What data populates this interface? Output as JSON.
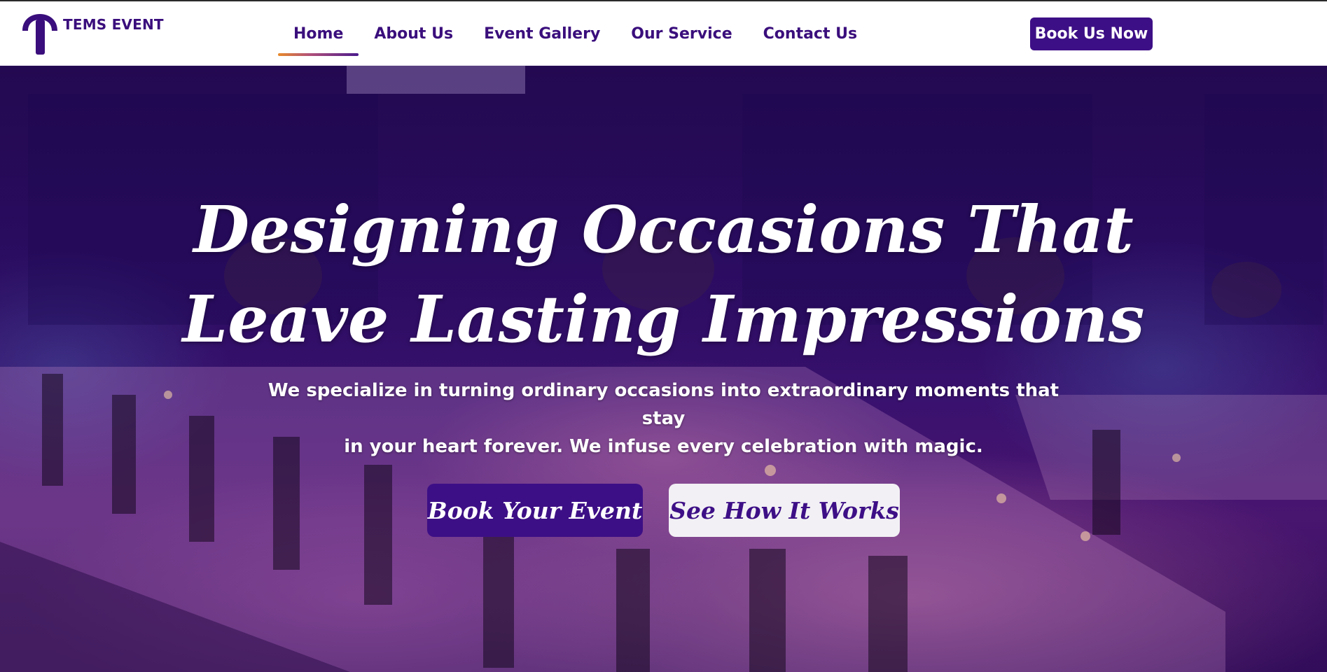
{
  "brand": {
    "logo_icon": "t-letter-logo-icon",
    "name": "TEMS EVENT",
    "color": "#3a0e7c"
  },
  "nav": {
    "items": [
      {
        "label": "Home",
        "active": true
      },
      {
        "label": "About Us",
        "active": false
      },
      {
        "label": "Event Gallery",
        "active": false
      },
      {
        "label": "Our Service",
        "active": false
      },
      {
        "label": "Contact Us",
        "active": false
      }
    ],
    "cta_label": "Book Us Now",
    "active_underline_colors": [
      "#e88a2a",
      "#4a1a8c"
    ]
  },
  "hero": {
    "headline_line1": "Designing Occasions That",
    "headline_line2": "Leave Lasting Impressions",
    "subtext_line1": "We specialize in turning ordinary occasions into extraordinary moments that stay",
    "subtext_line2": "in your heart forever. We infuse every celebration with magic.",
    "primary_cta": "Book Your Event",
    "secondary_cta": "See How It Works",
    "background_image": "banquet-hall-photo",
    "overlay_color": "#3d0f86"
  }
}
